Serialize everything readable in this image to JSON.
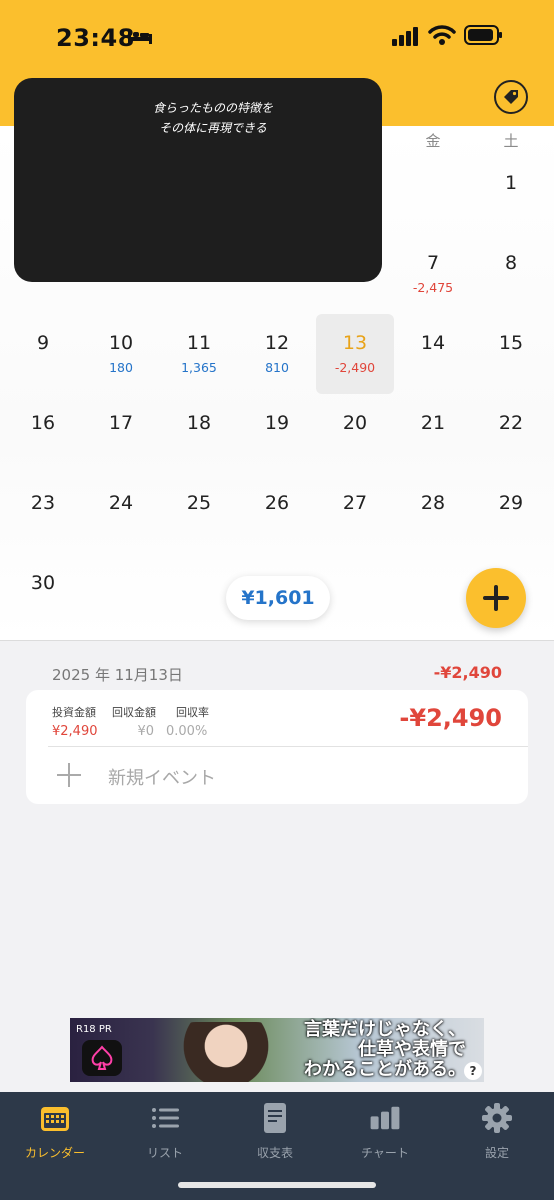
{
  "status_bar": {
    "time": "23:48"
  },
  "calendar": {
    "weekday_headers": [
      {
        "label": "金",
        "col": 5
      },
      {
        "label": "土",
        "col": 6
      }
    ],
    "days": [
      {
        "n": "1",
        "amt": "",
        "sign": ""
      },
      {
        "n": "7",
        "amt": "-2,475",
        "sign": "neg"
      },
      {
        "n": "8",
        "amt": "",
        "sign": ""
      },
      {
        "n": "9",
        "amt": "",
        "sign": ""
      },
      {
        "n": "10",
        "amt": "180",
        "sign": "pos"
      },
      {
        "n": "11",
        "amt": "1,365",
        "sign": "pos"
      },
      {
        "n": "12",
        "amt": "810",
        "sign": "pos"
      },
      {
        "n": "13",
        "amt": "-2,490",
        "sign": "neg",
        "selected": true
      },
      {
        "n": "14",
        "amt": "",
        "sign": ""
      },
      {
        "n": "15",
        "amt": "",
        "sign": ""
      },
      {
        "n": "16",
        "amt": "",
        "sign": ""
      },
      {
        "n": "17",
        "amt": "",
        "sign": ""
      },
      {
        "n": "18",
        "amt": "",
        "sign": ""
      },
      {
        "n": "19",
        "amt": "",
        "sign": ""
      },
      {
        "n": "20",
        "amt": "",
        "sign": ""
      },
      {
        "n": "21",
        "amt": "",
        "sign": ""
      },
      {
        "n": "22",
        "amt": "",
        "sign": ""
      },
      {
        "n": "23",
        "amt": "",
        "sign": ""
      },
      {
        "n": "24",
        "amt": "",
        "sign": ""
      },
      {
        "n": "25",
        "amt": "",
        "sign": ""
      },
      {
        "n": "26",
        "amt": "",
        "sign": ""
      },
      {
        "n": "27",
        "amt": "",
        "sign": ""
      },
      {
        "n": "28",
        "amt": "",
        "sign": ""
      },
      {
        "n": "29",
        "amt": "",
        "sign": ""
      },
      {
        "n": "30",
        "amt": "",
        "sign": ""
      }
    ],
    "month_total": "¥1,601"
  },
  "overlay": {
    "line1": "食らったものの特徴を",
    "line2": "その体に再現できる"
  },
  "detail": {
    "date_title": "2025 年 11月13日",
    "date_total": "-¥2,490",
    "invest_label": "投資金額",
    "invest_value": "¥2,490",
    "recover_label": "回収金額",
    "recover_value": "¥0",
    "rate_label": "回収率",
    "rate_value": "0.00%",
    "big_amount": "-¥2,490",
    "new_event": "新規イベント"
  },
  "ad": {
    "tag": "R18  PR",
    "copy_line1": "言葉だけじゃなく、",
    "copy_line2": "仕草や表情で",
    "copy_line3": "わかることがある。",
    "info_glyph": "?"
  },
  "tabbar": {
    "items": [
      {
        "label": "カレンダー",
        "icon": "calendar-icon",
        "active": true
      },
      {
        "label": "リスト",
        "icon": "list-icon"
      },
      {
        "label": "収支表",
        "icon": "document-icon"
      },
      {
        "label": "チャート",
        "icon": "bar-chart-icon"
      },
      {
        "label": "設定",
        "icon": "gear-icon"
      }
    ]
  },
  "colors": {
    "accent": "#fbbf2d",
    "positive": "#2574c9",
    "negative": "#e0463b",
    "tabbar": "#2d3949"
  }
}
